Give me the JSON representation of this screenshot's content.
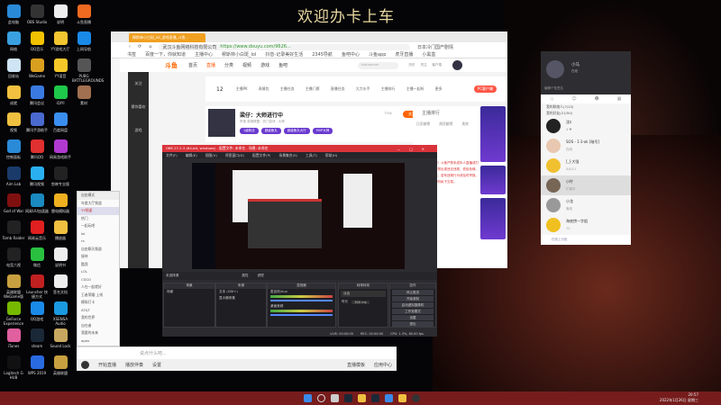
{
  "wallpaper_banner": "欢迎办卡上车",
  "desktop_icons": [
    {
      "label": "此电脑",
      "color": "#2a8ad8"
    },
    {
      "label": "OBS Studio",
      "color": "#333"
    },
    {
      "label": "说明",
      "color": "#eee"
    },
    {
      "label": "斗鱼直播",
      "color": "#f06a20"
    },
    {
      "label": "网络",
      "color": "#3aa0e0"
    },
    {
      "label": "QQ音乐",
      "color": "#f2c200"
    },
    {
      "label": "YY游戏大厅",
      "color": "#f3c530"
    },
    {
      "label": "上网导航",
      "color": "#1a8ae8"
    },
    {
      "label": "回收站",
      "color": "#cfe4f4"
    },
    {
      "label": "WeGame",
      "color": "#d9a020"
    },
    {
      "label": "YY语音",
      "color": "#f4c828"
    },
    {
      "label": "PUBG BATTLEGROUNDS",
      "color": "#555"
    },
    {
      "label": "成就",
      "color": "#f0c040"
    },
    {
      "label": "腾讯会议",
      "color": "#3a7ae0"
    },
    {
      "label": "iQIYI",
      "color": "#1ec84a"
    },
    {
      "label": "素材",
      "color": "#a07050"
    },
    {
      "label": "视频",
      "color": "#f0c040"
    },
    {
      "label": "腾讯手游助手",
      "color": "#4a6ad0"
    },
    {
      "label": "百度网盘",
      "color": "#3a8ef0"
    },
    {
      "label": "",
      "color": "transparent"
    },
    {
      "label": "控制面板",
      "color": "#2a8ad8"
    },
    {
      "label": "腾讯QQ",
      "color": "#e03030"
    },
    {
      "label": "网易游戏助手",
      "color": "#b03ad0"
    },
    {
      "label": "",
      "color": "transparent"
    },
    {
      "label": "Aim Lab",
      "color": "#1a3a6a"
    },
    {
      "label": "腾讯视频",
      "color": "#2ab0f0"
    },
    {
      "label": "剪映专业版",
      "color": "#222"
    },
    {
      "label": "",
      "color": "transparent"
    },
    {
      "label": "God of War",
      "color": "#801010"
    },
    {
      "label": "网易UU加速器",
      "color": "#1a8ac0"
    },
    {
      "label": "雷电模拟器",
      "color": "#f0b020"
    },
    {
      "label": "",
      "color": "transparent"
    },
    {
      "label": "Tomb Raider",
      "color": "#222"
    },
    {
      "label": "网易云音乐",
      "color": "#e02020"
    },
    {
      "label": "播放器",
      "color": "#f0c040"
    },
    {
      "label": "",
      "color": "transparent"
    },
    {
      "label": "电竞六视",
      "color": "#222"
    },
    {
      "label": "微信",
      "color": "#2ac040"
    },
    {
      "label": "说明书",
      "color": "#eee"
    },
    {
      "label": "",
      "color": "transparent"
    },
    {
      "label": "英雄联盟WeGame版",
      "color": "#c8a040"
    },
    {
      "label": "Launcher 快捷方式",
      "color": "#c02020"
    },
    {
      "label": "签名文档",
      "color": "#eee"
    },
    {
      "label": "",
      "color": "transparent"
    },
    {
      "label": "GeForce Experience",
      "color": "#76b900"
    },
    {
      "label": "QQ游戏",
      "color": "#1a8ae8"
    },
    {
      "label": "XSENSA Audio",
      "color": "#1a9ae0"
    },
    {
      "label": "",
      "color": "transparent"
    },
    {
      "label": "iTunes",
      "color": "#e060a0"
    },
    {
      "label": "steam",
      "color": "#1b2838"
    },
    {
      "label": "Sound Lock",
      "color": "#c8a860"
    },
    {
      "label": "",
      "color": "transparent"
    },
    {
      "label": "Logitech G HUB",
      "color": "#111"
    },
    {
      "label": "WPS 2019",
      "color": "#2a6ae0"
    },
    {
      "label": "英雄联盟",
      "color": "#c8a040"
    },
    {
      "label": "",
      "color": "transparent"
    }
  ],
  "browser": {
    "tab_title": "穆斯林小白斑_lol_游戏直播_斗鱼...",
    "company": "武汉斗鱼网络科技有限公司",
    "url": "https://www.douyu.com/9626...",
    "search_hint": "日本冷门国产剧情",
    "bookmarks": [
      "书签",
      "百度一下，你就知道",
      "主播中心",
      "穆斯林小白斑_lol",
      "抖音-记录美好生活",
      "2345导航",
      "鱼吧中心",
      "斗鱼app",
      "虎牙直播",
      "小黑盒"
    ],
    "site": {
      "logo": "斗鱼",
      "nav": [
        "首页",
        "直播",
        "分类",
        "视频",
        "游戏",
        "鱼吧"
      ],
      "search_placeholder": "lolstreamer",
      "header_icons": [
        "历史",
        "关注",
        "客户端"
      ],
      "sidebar": [
        "关注",
        "猜你喜欢",
        "游戏"
      ],
      "level": "12",
      "tools": [
        "主播PK",
        "表情包",
        "主播任务",
        "主播门票",
        "直播任务",
        "大力水手",
        "主播排行",
        "主播一起听",
        "更多"
      ],
      "pc_client": "PC客户端",
      "room_title": "梁仔：大师进行中",
      "room_meta": "举报  英雄联盟 · 热门游戏 · 大神",
      "follow_count": "755k",
      "follow": "关注",
      "tags": [
        "1级粉丝",
        "超级鱼丸",
        "超级鱼丸大厅",
        "MVP大神"
      ],
      "rank_tab": "主播排行",
      "side_tabs": [
        "日贡献榜",
        "周贡献榜",
        "贵宾"
      ],
      "red_notice": "欢迎来到直播间！斗鱼严禁未成年人直播或打赏。直播间内严禁出现违法违规、低俗色情、吸烟酗酒等内容，若有违规行为请及时举报。请理性消费，切勿私下交易。"
    }
  },
  "yy_list": {
    "mode": "自由模式",
    "channels": [
      "年度大厅频道",
      "YY频道",
      "热门",
      "一起玩吧",
      "lol",
      "rx",
      "自由聊天频道",
      "接待",
      "酷我",
      "LOL",
      "CSGO",
      "人在一起就好",
      "王者荣耀·上线",
      "模拟打卡",
      "AT&T",
      "我的世界",
      "自在者",
      "我要的未来",
      "apex",
      "· · · · ·"
    ]
  },
  "chat_bar": {
    "placeholder": "说点什么吧...",
    "bottom": [
      "开始直播",
      "播放伴奏",
      "设置"
    ],
    "right": [
      "直播模板",
      "应用中心"
    ]
  },
  "obs": {
    "title": "OBS 27.2.3 (64-bit, windows) - 配置文件: 未命名 - 场景: 未命名",
    "menu": [
      "文件(F)",
      "编辑(E)",
      "视图(V)",
      "停靠窗口(D)",
      "配置文件(P)",
      "场景集合(S)",
      "工具(T)",
      "帮助(H)"
    ],
    "no_source": "未选择源",
    "props": "属性",
    "filters": "滤镜",
    "panels": {
      "scenes": "场景",
      "sources": "来源",
      "mixer": "混音器",
      "transitions": "转场特效",
      "controls": "控件"
    },
    "scenes": [
      "场景"
    ],
    "sources": [
      "文本 (GDI+)",
      "显示器采集"
    ],
    "mixer": [
      "麦克风/Aux",
      "桌面音频"
    ],
    "transition": "淡出",
    "duration_label": "时长",
    "duration": "300 ms",
    "controls": [
      "停止推流",
      "开始录制",
      "启动虚拟摄像机",
      "工作室模式",
      "设置",
      "退出"
    ],
    "status": [
      "LIVE: 00:00:00",
      "REC: 00:00:00",
      "CPU: 1.3%, 60.00 fps"
    ]
  },
  "qq": {
    "name": "小马",
    "status": "在线",
    "signature": "编辑个性签名",
    "groups": [
      "我的联络人(7/15)",
      "我的好友(21/50)"
    ],
    "friends": [
      {
        "name": "沈z",
        "sub": "4 ♥",
        "color": "#222"
      },
      {
        "name": "SOS - 1·3·ok [暗号]",
        "sub": "在线",
        "color": "#e8c8b0"
      },
      {
        "name": "[_]·大强",
        "sub": "5/4/11",
        "color": "#f0c030"
      },
      {
        "name": "小柠",
        "sub": "忙碌中",
        "color": "#776655"
      },
      {
        "name": "小龙",
        "sub": "离线",
        "color": "#999"
      },
      {
        "name": "海底捞一字姐",
        "sub": "72",
        "color": "#f0c020"
      }
    ],
    "footer": "在线上分批"
  },
  "taskbar": {
    "clock": "20:57",
    "date": "2022年1月26日 星期三"
  }
}
